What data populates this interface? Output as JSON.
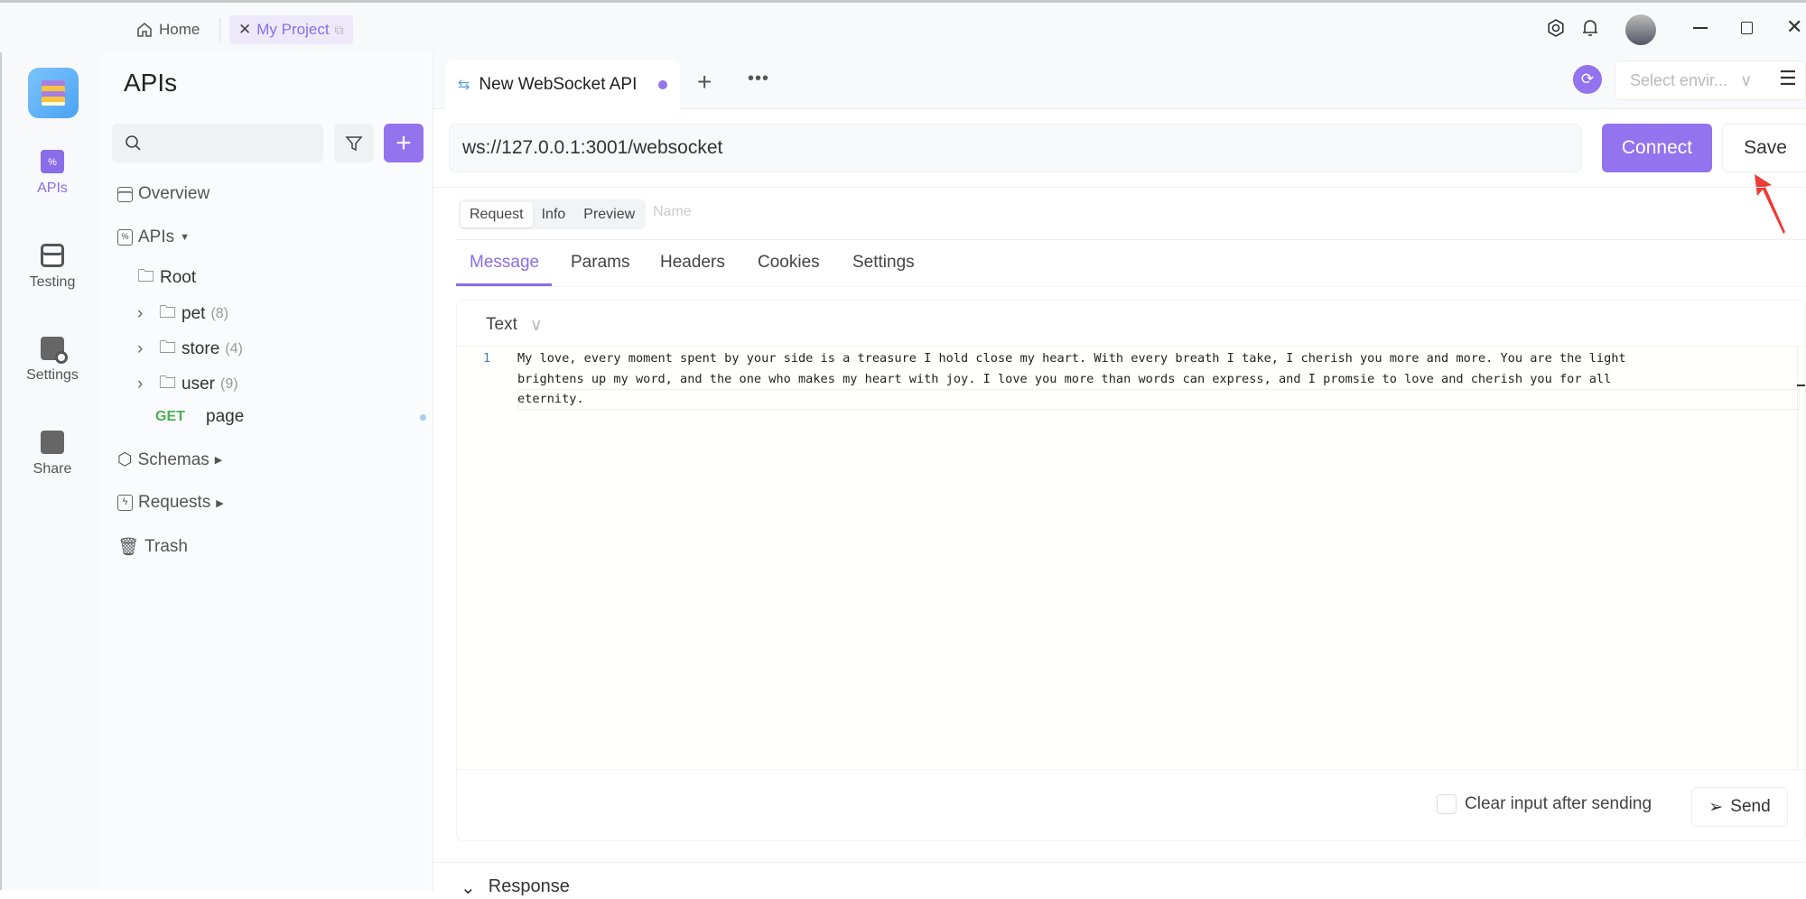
{
  "window": {
    "home_tab": "Home",
    "project_tab": "My Project"
  },
  "rail": {
    "items": [
      {
        "label": "APIs"
      },
      {
        "label": "Testing"
      },
      {
        "label": "Settings"
      },
      {
        "label": "Share"
      }
    ]
  },
  "sidebar": {
    "title": "APIs",
    "search_placeholder": "",
    "overview": "Overview",
    "apis": "APIs",
    "root": "Root",
    "folders": [
      {
        "name": "pet",
        "count": "(8)"
      },
      {
        "name": "store",
        "count": "(4)"
      },
      {
        "name": "user",
        "count": "(9)"
      }
    ],
    "endpoint": {
      "method": "GET",
      "name": "page"
    },
    "schemas": "Schemas",
    "requests": "Requests",
    "trash": "Trash"
  },
  "tabs": {
    "active": "New WebSocket API"
  },
  "env": {
    "placeholder": "Select envir..."
  },
  "request": {
    "url": "ws://127.0.0.1:3001/websocket",
    "connect": "Connect",
    "save": "Save",
    "modes": [
      "Request",
      "Info",
      "Preview"
    ],
    "name_placeholder": "Name",
    "subtabs": [
      "Message",
      "Params",
      "Headers",
      "Cookies",
      "Settings"
    ],
    "body_type": "Text",
    "line_number": "1",
    "lines": [
      "My love, every moment spent by your side is a treasure I hold close my heart. With every breath I take, I cherish you more and more. You are the light",
      "brightens up my word, and the one who makes my heart with joy. I love you more than words can express, and I promsie to love and cherish you for all",
      "eternity."
    ],
    "clear_label": "Clear input after sending",
    "clear_checked": false,
    "send": "Send"
  },
  "response": {
    "label": "Response"
  },
  "colors": {
    "accent": "#9373ee",
    "get": "#4caf50",
    "arrow": "#ee3b34"
  }
}
